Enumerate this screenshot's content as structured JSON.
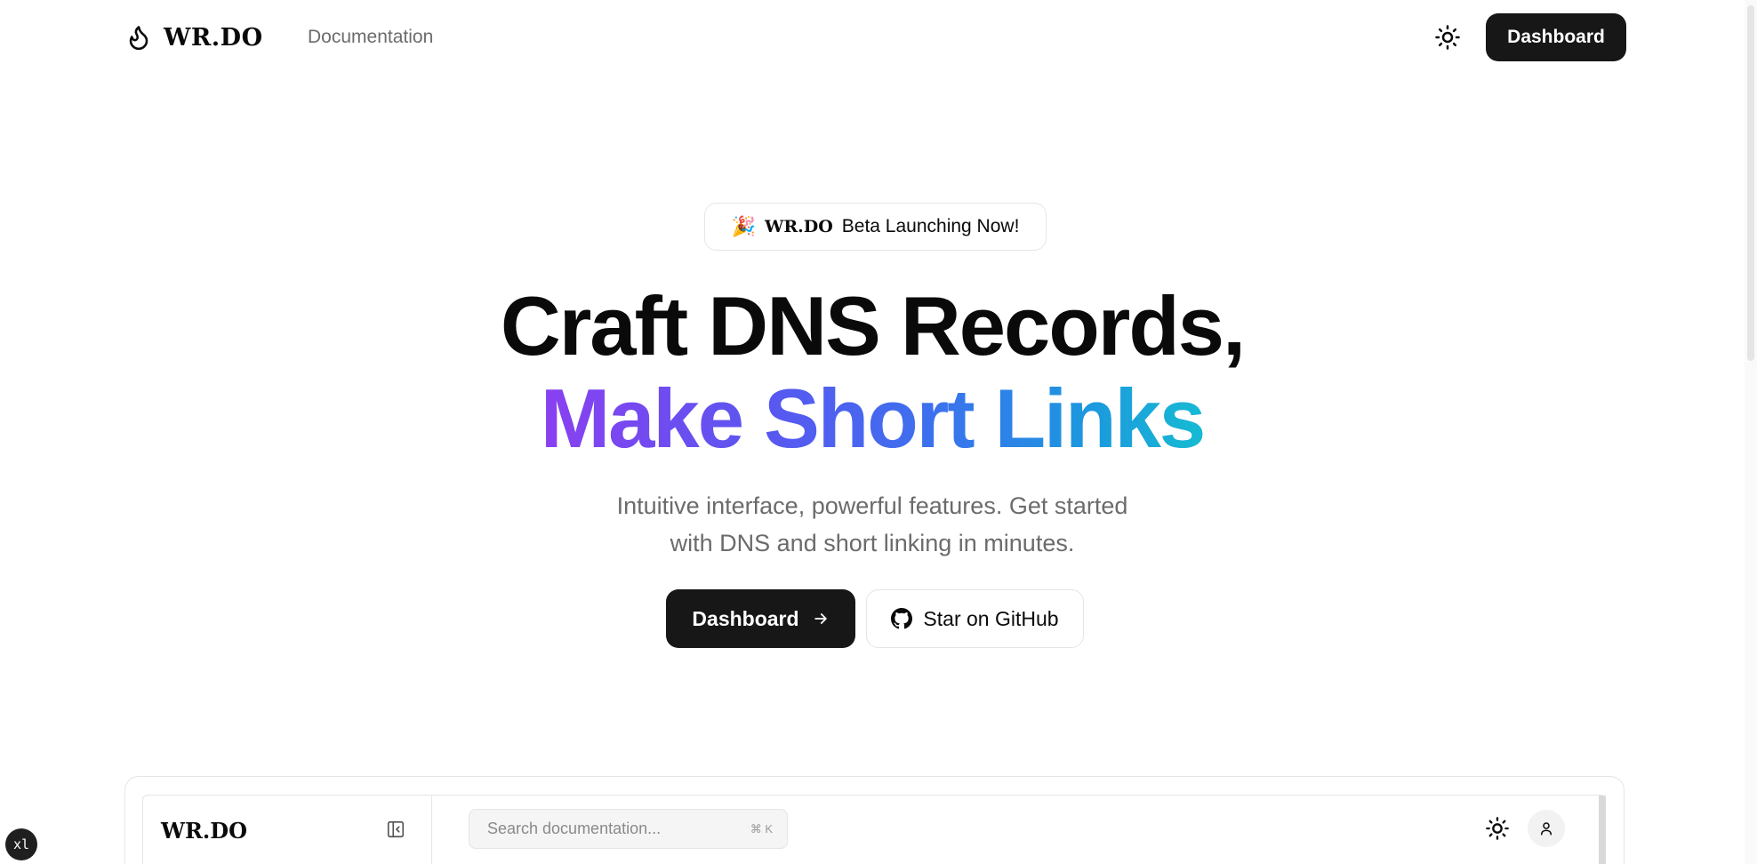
{
  "header": {
    "brand": "WR.DO",
    "nav_documentation": "Documentation",
    "theme_icon": "sun-icon",
    "dashboard_label": "Dashboard"
  },
  "hero": {
    "badge_emoji": "🎉",
    "badge_brand": "WR.DO",
    "badge_text": "Beta Launching Now!",
    "title_line1": "Craft DNS Records,",
    "title_line2": "Make Short Links",
    "title_gradient": [
      "#8b3ff0",
      "#3b6ef0",
      "#17b8d4"
    ],
    "subtitle_line1": "Intuitive interface, powerful features. Get started",
    "subtitle_line2": "with DNS and short linking in minutes.",
    "cta_primary_label": "Dashboard",
    "cta_primary_icon": "arrow-right-icon",
    "cta_secondary_label": "Star on GitHub",
    "cta_secondary_icon": "github-icon"
  },
  "preview": {
    "brand": "WR.DO",
    "collapse_icon": "sidebar-collapse-icon",
    "search_placeholder": "Search documentation...",
    "search_shortcut": "⌘ K",
    "theme_icon": "sun-icon",
    "user_icon": "user-icon"
  },
  "corner_badge": "xl",
  "colors": {
    "primary_button": "#171717",
    "muted_text": "#6b6b6b",
    "border": "#e5e5e5"
  }
}
